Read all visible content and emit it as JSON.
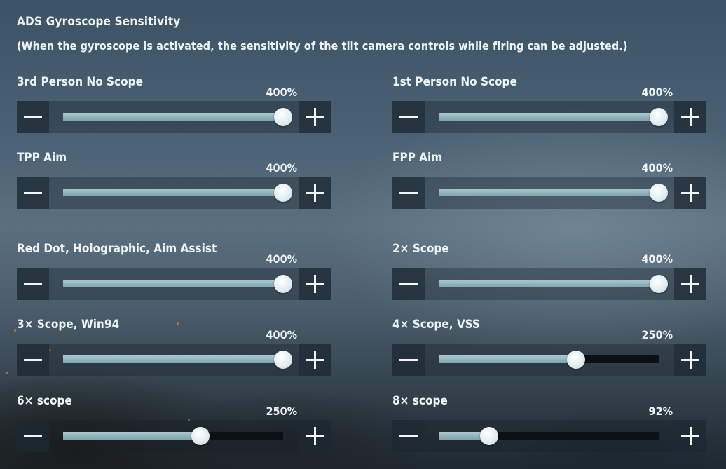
{
  "header": {
    "title": "ADS Gyroscope Sensitivity",
    "subtitle": "(When the gyroscope is activated, the sensitivity of the tilt camera controls while firing can be adjusted.)"
  },
  "settings": [
    {
      "label": "3rd Person No Scope",
      "value_text": "400%",
      "value": 400,
      "max": 400
    },
    {
      "label": "1st Person No Scope",
      "value_text": "400%",
      "value": 400,
      "max": 400
    },
    {
      "label": "TPP Aim",
      "value_text": "400%",
      "value": 400,
      "max": 400
    },
    {
      "label": "FPP Aim",
      "value_text": "400%",
      "value": 400,
      "max": 400
    },
    {
      "label": "Red Dot, Holographic, Aim Assist",
      "value_text": "400%",
      "value": 400,
      "max": 400
    },
    {
      "label": "2× Scope",
      "value_text": "400%",
      "value": 400,
      "max": 400
    },
    {
      "label": "3× Scope, Win94",
      "value_text": "400%",
      "value": 400,
      "max": 400
    },
    {
      "label": "4× Scope, VSS",
      "value_text": "250%",
      "value": 250,
      "max": 400
    },
    {
      "label": "6× scope",
      "value_text": "250%",
      "value": 250,
      "max": 400
    },
    {
      "label": "8× scope",
      "value_text": "92%",
      "value": 92,
      "max": 400
    }
  ],
  "icons": {
    "decrease": "minus-icon",
    "increase": "plus-icon"
  },
  "colors": {
    "slider_fill": "#8fb3b9",
    "slider_track": "#0b1015",
    "button_bg": "#1c2832",
    "text": "#eef3f6"
  }
}
